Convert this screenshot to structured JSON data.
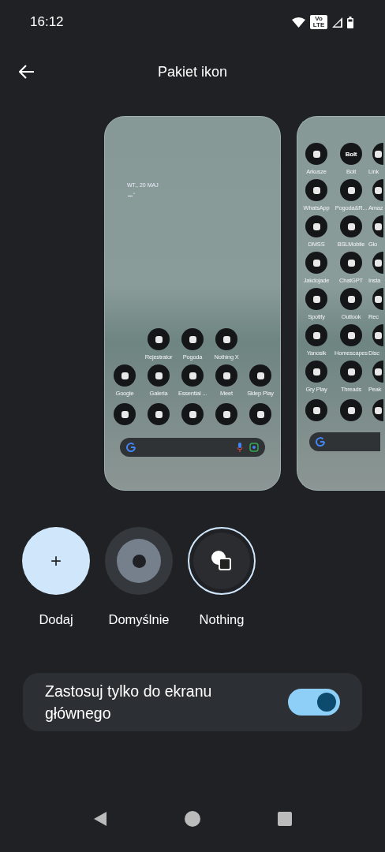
{
  "status_bar": {
    "time": "16:12",
    "volte": "Vo LTE"
  },
  "header": {
    "title": "Pakiet ikon"
  },
  "preview_home": {
    "date": "WT., 20 MAJ",
    "rows": [
      [
        {},
        {
          "label": "Rejestrator"
        },
        {
          "label": "Pogoda"
        },
        {
          "label": "Nothing X"
        },
        {}
      ],
      [
        {
          "label": "Google"
        },
        {
          "label": "Galeria"
        },
        {
          "label": "Essential ..."
        },
        {
          "label": "Meet"
        },
        {
          "label": "Sklep Play"
        }
      ]
    ]
  },
  "preview_apps": {
    "rows": [
      [
        {
          "label": "Arkusze"
        },
        {
          "label": "Bolt",
          "glyph": "Bolt"
        },
        {
          "label": "Link"
        }
      ],
      [
        {
          "label": "WhatsApp"
        },
        {
          "label": "Pogoda&R..."
        },
        {
          "label": "Amaz"
        }
      ],
      [
        {
          "label": "DMSS"
        },
        {
          "label": "BSLMobile"
        },
        {
          "label": "Glo"
        }
      ],
      [
        {
          "label": "Jakdojade"
        },
        {
          "label": "ChatGPT"
        },
        {
          "label": "Insta"
        }
      ],
      [
        {
          "label": "Spotify"
        },
        {
          "label": "Outlook"
        },
        {
          "label": "Rec"
        }
      ],
      [
        {
          "label": "Yanosik"
        },
        {
          "label": "Homescapes"
        },
        {
          "label": "Disc"
        }
      ],
      [
        {
          "label": "Gry Play"
        },
        {
          "label": "Threads"
        },
        {
          "label": "Peak"
        }
      ]
    ]
  },
  "options": [
    {
      "kind": "add",
      "symbol": "+",
      "label": "Dodaj",
      "selected": false
    },
    {
      "kind": "default",
      "label": "Domyślnie",
      "selected": false
    },
    {
      "kind": "pack",
      "label": "Nothing",
      "selected": true
    }
  ],
  "toggle": {
    "label": "Zastosuj tylko do ekranu głównego",
    "on": true
  }
}
